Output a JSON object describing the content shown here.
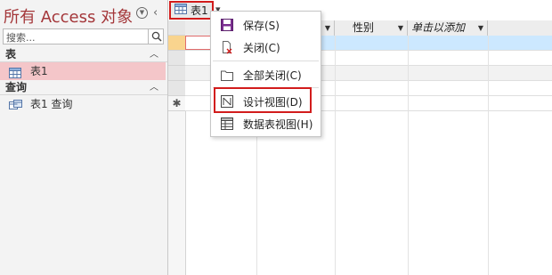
{
  "nav": {
    "title": "所有 Access 对象",
    "search_placeholder": "搜索...",
    "groups": [
      {
        "label": "表",
        "items": [
          {
            "label": "表1",
            "icon": "table-icon"
          }
        ]
      },
      {
        "label": "查询",
        "items": [
          {
            "label": "表1 查询",
            "icon": "query-icon"
          }
        ]
      }
    ]
  },
  "doc_tab": {
    "label": "表1"
  },
  "grid": {
    "columns": [
      "",
      "",
      "性别",
      "单击以添加"
    ],
    "new_record_marker": "✱"
  },
  "menu": {
    "items": [
      {
        "label": "保存(S)",
        "icon": "save-icon"
      },
      {
        "label": "关闭(C)",
        "icon": "close-doc-icon"
      },
      {
        "label": "全部关闭(C)",
        "icon": "close-all-icon"
      },
      {
        "label": "设计视图(D)",
        "icon": "design-view-icon"
      },
      {
        "label": "数据表视图(H)",
        "icon": "datasheet-view-icon"
      }
    ]
  },
  "colors": {
    "accent": "#a4373a",
    "highlight_box": "#d21c1c",
    "selected_item": "#f4c6c9",
    "selected_row": "#cce8ff"
  }
}
